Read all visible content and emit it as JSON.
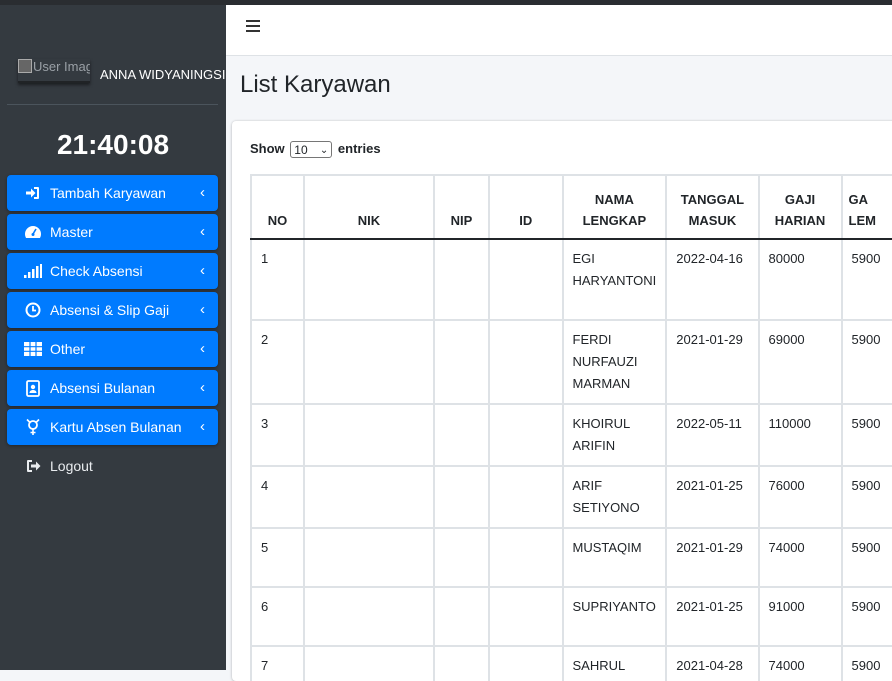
{
  "sidebar": {
    "user": {
      "image_alt": "User Image",
      "name": "ANNA WIDYANINGSI"
    },
    "clock": "21:40:08",
    "menu": [
      {
        "label": "Tambah Karyawan",
        "icon": "sign-in-icon"
      },
      {
        "label": "Master",
        "icon": "dashboard-icon"
      },
      {
        "label": "Check Absensi",
        "icon": "signal-icon"
      },
      {
        "label": "Absensi & Slip Gaji",
        "icon": "clock-icon"
      },
      {
        "label": "Other",
        "icon": "table-icon"
      },
      {
        "label": "Absensi Bulanan",
        "icon": "id-badge-icon"
      },
      {
        "label": "Kartu Absen Bulanan",
        "icon": "genderless-icon"
      }
    ],
    "logout": "Logout"
  },
  "page": {
    "title": "List Karyawan"
  },
  "table_controls": {
    "show_label": "Show",
    "entries_value": "10",
    "entries_label": "entries"
  },
  "table": {
    "headers": {
      "no": "NO",
      "nik": "NIK",
      "nip": "NIP",
      "id": "ID",
      "nama_1": "NAMA",
      "nama_2": "LENGKAP",
      "tanggal_1": "TANGGAL",
      "tanggal_2": "MASUK",
      "gaji_harian_1": "GAJI",
      "gaji_harian_2": "HARIAN",
      "gaji_lembur_1": "GA",
      "gaji_lembur_2": "LEM"
    },
    "rows": [
      {
        "no": "1",
        "nik": "",
        "nip": "",
        "id": "",
        "nama": "EGI HARYANTONI",
        "tanggal": "2022-04-16",
        "gaji_harian": "80000",
        "gaji_lembur": "5900"
      },
      {
        "no": "2",
        "nik": "",
        "nip": "",
        "id": "",
        "nama": "FERDI NURFAUZI MARMAN",
        "tanggal": "2021-01-29",
        "gaji_harian": "69000",
        "gaji_lembur": "5900"
      },
      {
        "no": "3",
        "nik": "",
        "nip": "",
        "id": "",
        "nama": "KHOIRUL ARIFIN",
        "tanggal": "2022-05-11",
        "gaji_harian": "110000",
        "gaji_lembur": "5900"
      },
      {
        "no": "4",
        "nik": "",
        "nip": "",
        "id": "",
        "nama": "ARIF SETIYONO",
        "tanggal": "2021-01-25",
        "gaji_harian": "76000",
        "gaji_lembur": "5900"
      },
      {
        "no": "5",
        "nik": "",
        "nip": "",
        "id": "",
        "nama": "MUSTAQIM",
        "tanggal": "2021-01-29",
        "gaji_harian": "74000",
        "gaji_lembur": "5900"
      },
      {
        "no": "6",
        "nik": "",
        "nip": "",
        "id": "",
        "nama": "SUPRIYANTO",
        "tanggal": "2021-01-25",
        "gaji_harian": "91000",
        "gaji_lembur": "5900"
      },
      {
        "no": "7",
        "nik": "",
        "nip": "",
        "id": "",
        "nama": "SAHRUL",
        "tanggal": "2021-04-28",
        "gaji_harian": "74000",
        "gaji_lembur": "5900"
      }
    ]
  },
  "colors": {
    "sidebar_bg": "#343a40",
    "menu_blue": "#007bff",
    "content_bg": "#f4f6f9"
  }
}
